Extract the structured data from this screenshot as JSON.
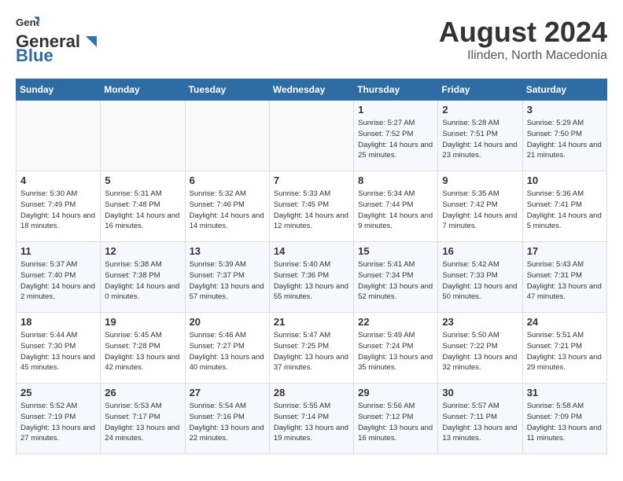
{
  "logo": {
    "text_general": "General",
    "text_blue": "Blue"
  },
  "title": "August 2024",
  "location": "Ilinden, North Macedonia",
  "days_of_week": [
    "Sunday",
    "Monday",
    "Tuesday",
    "Wednesday",
    "Thursday",
    "Friday",
    "Saturday"
  ],
  "weeks": [
    [
      {
        "day": "",
        "info": ""
      },
      {
        "day": "",
        "info": ""
      },
      {
        "day": "",
        "info": ""
      },
      {
        "day": "",
        "info": ""
      },
      {
        "day": "1",
        "info": "Sunrise: 5:27 AM\nSunset: 7:52 PM\nDaylight: 14 hours and 25 minutes."
      },
      {
        "day": "2",
        "info": "Sunrise: 5:28 AM\nSunset: 7:51 PM\nDaylight: 14 hours and 23 minutes."
      },
      {
        "day": "3",
        "info": "Sunrise: 5:29 AM\nSunset: 7:50 PM\nDaylight: 14 hours and 21 minutes."
      }
    ],
    [
      {
        "day": "4",
        "info": "Sunrise: 5:30 AM\nSunset: 7:49 PM\nDaylight: 14 hours and 18 minutes."
      },
      {
        "day": "5",
        "info": "Sunrise: 5:31 AM\nSunset: 7:48 PM\nDaylight: 14 hours and 16 minutes."
      },
      {
        "day": "6",
        "info": "Sunrise: 5:32 AM\nSunset: 7:46 PM\nDaylight: 14 hours and 14 minutes."
      },
      {
        "day": "7",
        "info": "Sunrise: 5:33 AM\nSunset: 7:45 PM\nDaylight: 14 hours and 12 minutes."
      },
      {
        "day": "8",
        "info": "Sunrise: 5:34 AM\nSunset: 7:44 PM\nDaylight: 14 hours and 9 minutes."
      },
      {
        "day": "9",
        "info": "Sunrise: 5:35 AM\nSunset: 7:42 PM\nDaylight: 14 hours and 7 minutes."
      },
      {
        "day": "10",
        "info": "Sunrise: 5:36 AM\nSunset: 7:41 PM\nDaylight: 14 hours and 5 minutes."
      }
    ],
    [
      {
        "day": "11",
        "info": "Sunrise: 5:37 AM\nSunset: 7:40 PM\nDaylight: 14 hours and 2 minutes."
      },
      {
        "day": "12",
        "info": "Sunrise: 5:38 AM\nSunset: 7:38 PM\nDaylight: 14 hours and 0 minutes."
      },
      {
        "day": "13",
        "info": "Sunrise: 5:39 AM\nSunset: 7:37 PM\nDaylight: 13 hours and 57 minutes."
      },
      {
        "day": "14",
        "info": "Sunrise: 5:40 AM\nSunset: 7:36 PM\nDaylight: 13 hours and 55 minutes."
      },
      {
        "day": "15",
        "info": "Sunrise: 5:41 AM\nSunset: 7:34 PM\nDaylight: 13 hours and 52 minutes."
      },
      {
        "day": "16",
        "info": "Sunrise: 5:42 AM\nSunset: 7:33 PM\nDaylight: 13 hours and 50 minutes."
      },
      {
        "day": "17",
        "info": "Sunrise: 5:43 AM\nSunset: 7:31 PM\nDaylight: 13 hours and 47 minutes."
      }
    ],
    [
      {
        "day": "18",
        "info": "Sunrise: 5:44 AM\nSunset: 7:30 PM\nDaylight: 13 hours and 45 minutes."
      },
      {
        "day": "19",
        "info": "Sunrise: 5:45 AM\nSunset: 7:28 PM\nDaylight: 13 hours and 42 minutes."
      },
      {
        "day": "20",
        "info": "Sunrise: 5:46 AM\nSunset: 7:27 PM\nDaylight: 13 hours and 40 minutes."
      },
      {
        "day": "21",
        "info": "Sunrise: 5:47 AM\nSunset: 7:25 PM\nDaylight: 13 hours and 37 minutes."
      },
      {
        "day": "22",
        "info": "Sunrise: 5:49 AM\nSunset: 7:24 PM\nDaylight: 13 hours and 35 minutes."
      },
      {
        "day": "23",
        "info": "Sunrise: 5:50 AM\nSunset: 7:22 PM\nDaylight: 13 hours and 32 minutes."
      },
      {
        "day": "24",
        "info": "Sunrise: 5:51 AM\nSunset: 7:21 PM\nDaylight: 13 hours and 29 minutes."
      }
    ],
    [
      {
        "day": "25",
        "info": "Sunrise: 5:52 AM\nSunset: 7:19 PM\nDaylight: 13 hours and 27 minutes."
      },
      {
        "day": "26",
        "info": "Sunrise: 5:53 AM\nSunset: 7:17 PM\nDaylight: 13 hours and 24 minutes."
      },
      {
        "day": "27",
        "info": "Sunrise: 5:54 AM\nSunset: 7:16 PM\nDaylight: 13 hours and 22 minutes."
      },
      {
        "day": "28",
        "info": "Sunrise: 5:55 AM\nSunset: 7:14 PM\nDaylight: 13 hours and 19 minutes."
      },
      {
        "day": "29",
        "info": "Sunrise: 5:56 AM\nSunset: 7:12 PM\nDaylight: 13 hours and 16 minutes."
      },
      {
        "day": "30",
        "info": "Sunrise: 5:57 AM\nSunset: 7:11 PM\nDaylight: 13 hours and 13 minutes."
      },
      {
        "day": "31",
        "info": "Sunrise: 5:58 AM\nSunset: 7:09 PM\nDaylight: 13 hours and 11 minutes."
      }
    ]
  ]
}
